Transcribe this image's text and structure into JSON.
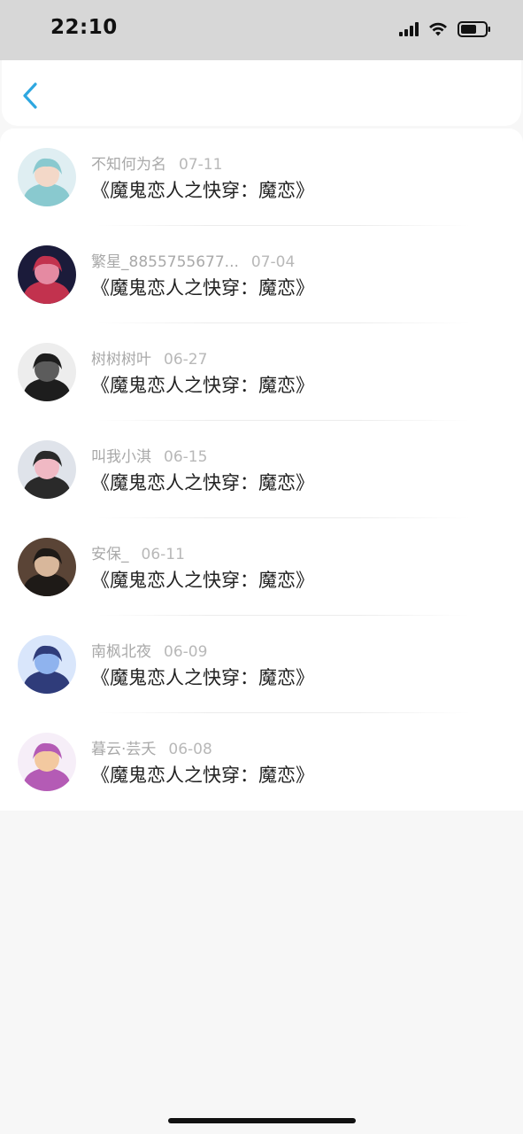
{
  "status_bar": {
    "time": "22:10"
  },
  "header": {
    "back_icon": "chevron-left-icon",
    "accent_color": "#2ea7e0"
  },
  "comments": [
    {
      "username": "不知何为名",
      "date": "07-11",
      "text": "《魔鬼恋人之快穿：魔恋》",
      "avatar_colors": [
        "#dfeef2",
        "#89c9cf",
        "#f3d8c8"
      ]
    },
    {
      "username": "繁星_8855755677...",
      "date": "07-04",
      "text": "《魔鬼恋人之快穿：魔恋》",
      "avatar_colors": [
        "#1b1b3a",
        "#c2324e",
        "#e58aa2"
      ]
    },
    {
      "username": "树树树叶",
      "date": "06-27",
      "text": "《魔鬼恋人之快穿：魔恋》",
      "avatar_colors": [
        "#ededed",
        "#1d1d1d",
        "#5c5c5c"
      ]
    },
    {
      "username": "叫我小淇",
      "date": "06-15",
      "text": "《魔鬼恋人之快穿：魔恋》",
      "avatar_colors": [
        "#dfe3ea",
        "#2a2a2a",
        "#f0b9c4"
      ]
    },
    {
      "username": "安保_",
      "date": "06-11",
      "text": "《魔鬼恋人之快穿：魔恋》",
      "avatar_colors": [
        "#5a4436",
        "#1e1a17",
        "#d8b79b"
      ]
    },
    {
      "username": "南枫北夜",
      "date": "06-09",
      "text": "《魔鬼恋人之快穿：魔恋》",
      "avatar_colors": [
        "#d9e6fb",
        "#2f3c7a",
        "#8fb3ee"
      ]
    },
    {
      "username": "暮云·芸夭",
      "date": "06-08",
      "text": "《魔鬼恋人之快穿：魔恋》",
      "avatar_colors": [
        "#f6eef8",
        "#b45bb5",
        "#f3c9a0"
      ]
    }
  ]
}
